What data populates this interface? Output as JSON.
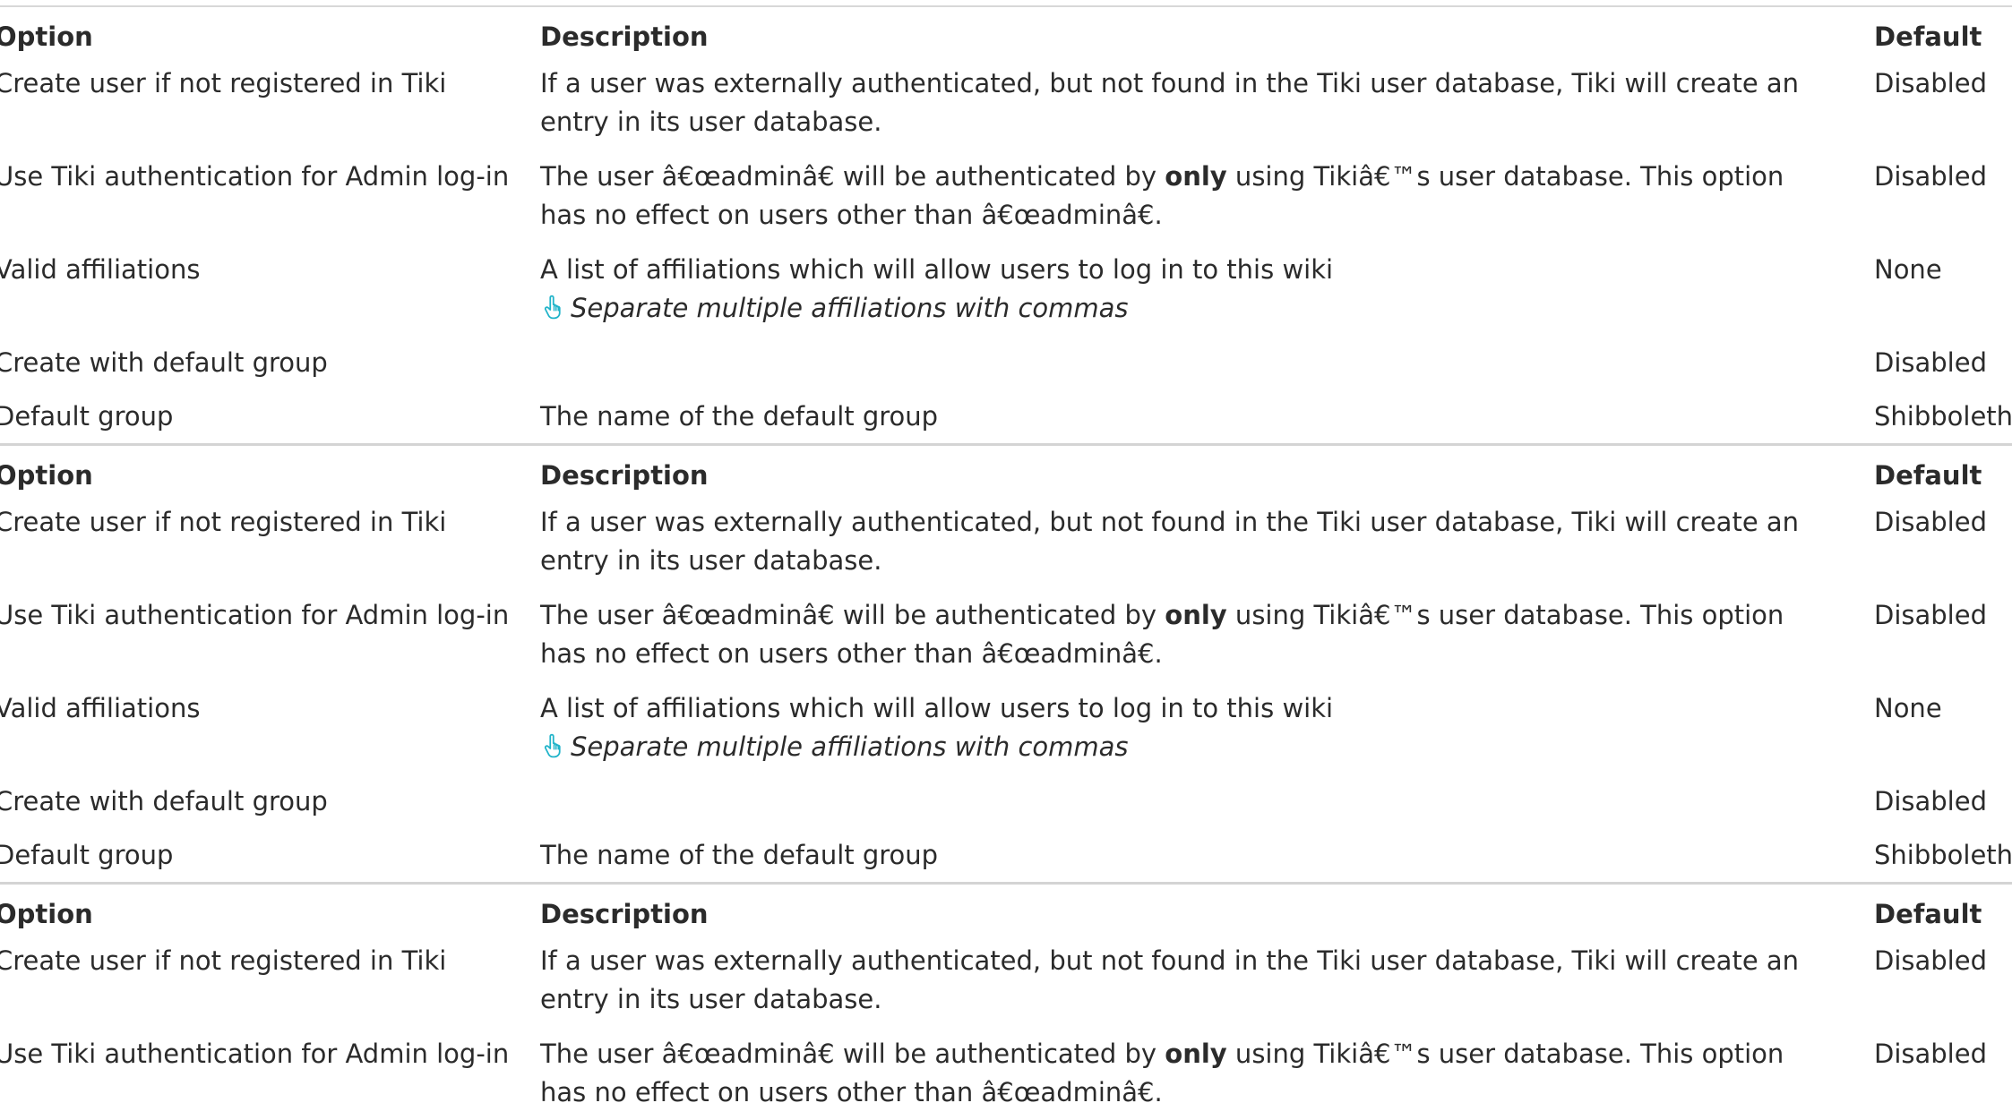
{
  "headers": {
    "option": "Option",
    "description": "Description",
    "default": "Default"
  },
  "rows": [
    {
      "option": "Create user if not registered in Tiki",
      "description": "If a user was externally authenticated, but not found in the Tiki user database, Tiki will create an entry in its user database.",
      "default": "Disabled"
    },
    {
      "option": "Use Tiki authentication for Admin log-in",
      "description_pre": "The user â€œadminâ€ will be authenticated by ",
      "description_bold": "only",
      "description_post": " using Tikiâ€™s user database. This option has no effect on users other than â€œadminâ€.",
      "default": "Disabled"
    },
    {
      "option": "Valid affiliations",
      "description": "A list of affiliations which will allow users to log in to this wiki",
      "tip": "Separate multiple affiliations with commas",
      "tip_icon": "pointing-hand-icon",
      "default": "None"
    },
    {
      "option": "Create with default group",
      "description": "",
      "default": "Disabled"
    },
    {
      "option": "Default group",
      "description": "The name of the default group",
      "default": "Shibboleth"
    }
  ],
  "colors": {
    "text": "#2b2b2b",
    "border": "#d4d4d4",
    "icon": "#1fb3c9"
  }
}
